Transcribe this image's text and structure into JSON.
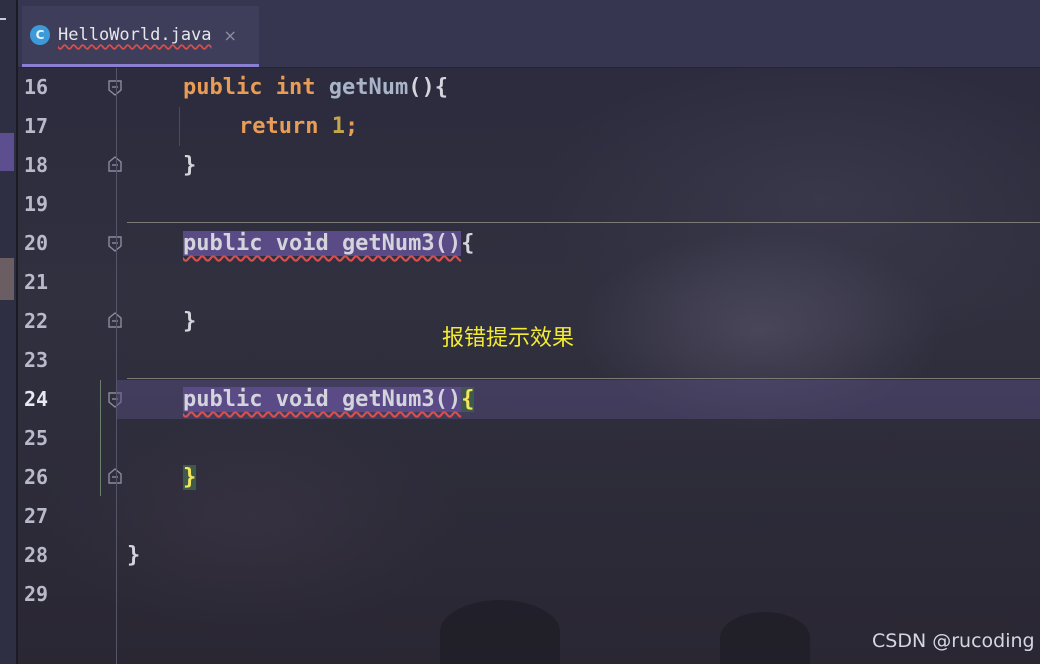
{
  "tab": {
    "icon": "C",
    "file_name": "HelloWorld.java",
    "close_icon": "×"
  },
  "gutter": {
    "line_numbers": [
      "16",
      "17",
      "18",
      "19",
      "20",
      "21",
      "22",
      "23",
      "24",
      "25",
      "26",
      "27",
      "28",
      "29"
    ],
    "current_line": "24"
  },
  "code": {
    "line16": {
      "kw1": "public",
      "kw2": "int",
      "name": "getNum",
      "rest": "(){"
    },
    "line17": {
      "kw": "return",
      "num": "1",
      "semi": ";"
    },
    "line18": {
      "text": "}"
    },
    "line20": {
      "sig": "public void getNum3()",
      "brace": "{"
    },
    "line22": {
      "text": "}"
    },
    "line24": {
      "sig": "public void getNum3()",
      "brace": "{"
    },
    "line26": {
      "text": "}"
    },
    "line28": {
      "text": "}"
    }
  },
  "annotation": "报错提示效果",
  "watermark": "CSDN @rucoding",
  "colors": {
    "keyword": "#e89c55",
    "error_underline": "#d94f4f",
    "annotation": "#f3ea33",
    "tab_accent": "#8a7fd1"
  }
}
